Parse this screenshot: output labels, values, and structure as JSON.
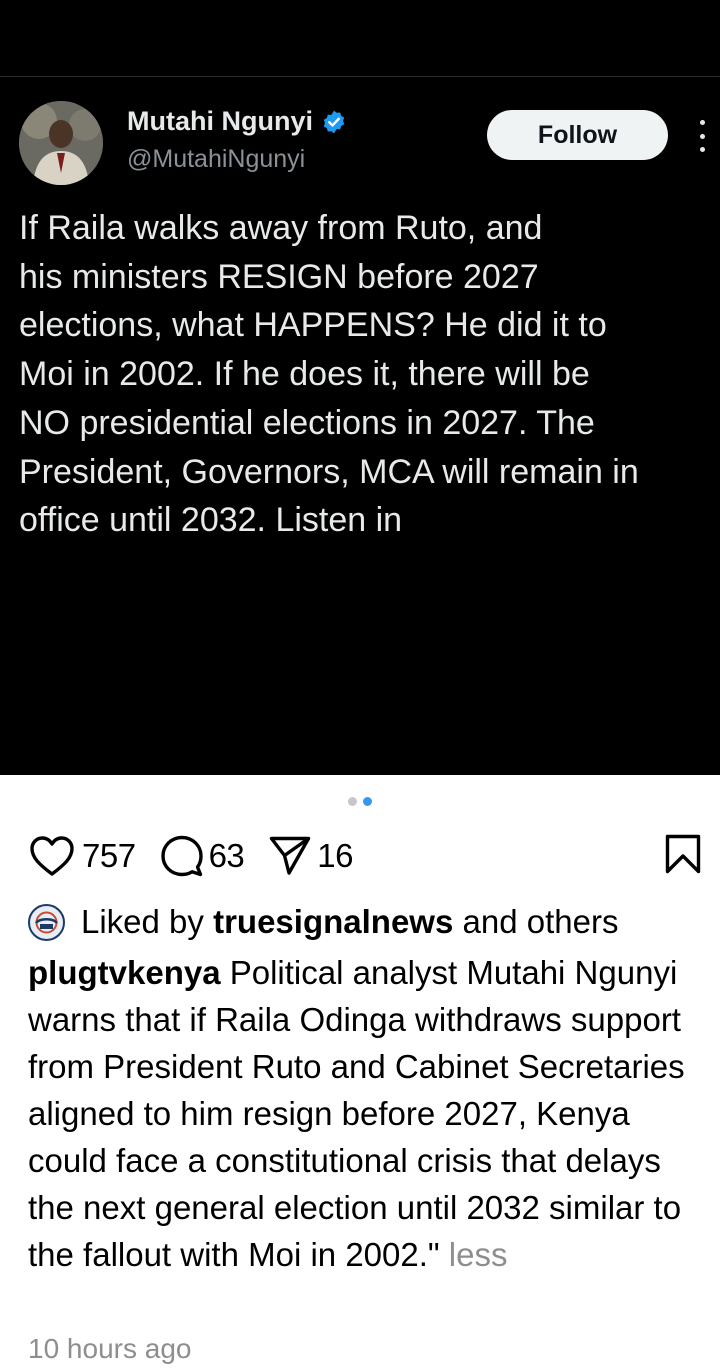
{
  "tweet": {
    "display_name": "Mutahi Ngunyi",
    "handle": "@MutahiNgunyi",
    "follow_label": "Follow",
    "text": "If Raila walks away from Ruto, and\nhis ministers RESIGN before 2027\nelections, what HAPPENS? He did it to\nMoi in 2002. If he does it, there will be\nNO presidential elections in 2027. The\nPresident, Governors, MCA will remain in\noffice until 2032. Listen in",
    "verified_icon": "verified-badge-icon",
    "verified_color": "#1d9bf0"
  },
  "carousel": {
    "total": 2,
    "active_index": 2,
    "active_color": "#3897f0"
  },
  "actions": {
    "likes": "757",
    "comments": "63",
    "shares": "16",
    "like_icon": "heart-icon",
    "comment_icon": "comment-bubble-icon",
    "share_icon": "send-icon",
    "save_icon": "bookmark-icon"
  },
  "liked_by": {
    "prefix": "Liked by",
    "user": "truesignalnews",
    "suffix": "and others"
  },
  "caption": {
    "username": "plugtvkenya",
    "text": "Political analyst Mutahi Ngunyi warns that if Raila Odinga withdraws support from President Ruto and Cabinet Secretaries aligned to him resign before 2027, Kenya could face a constitutional crisis that delays the next general election until 2032 similar to the fallout with Moi in 2002.\"",
    "less_label": "less"
  },
  "timestamp": "10 hours ago"
}
